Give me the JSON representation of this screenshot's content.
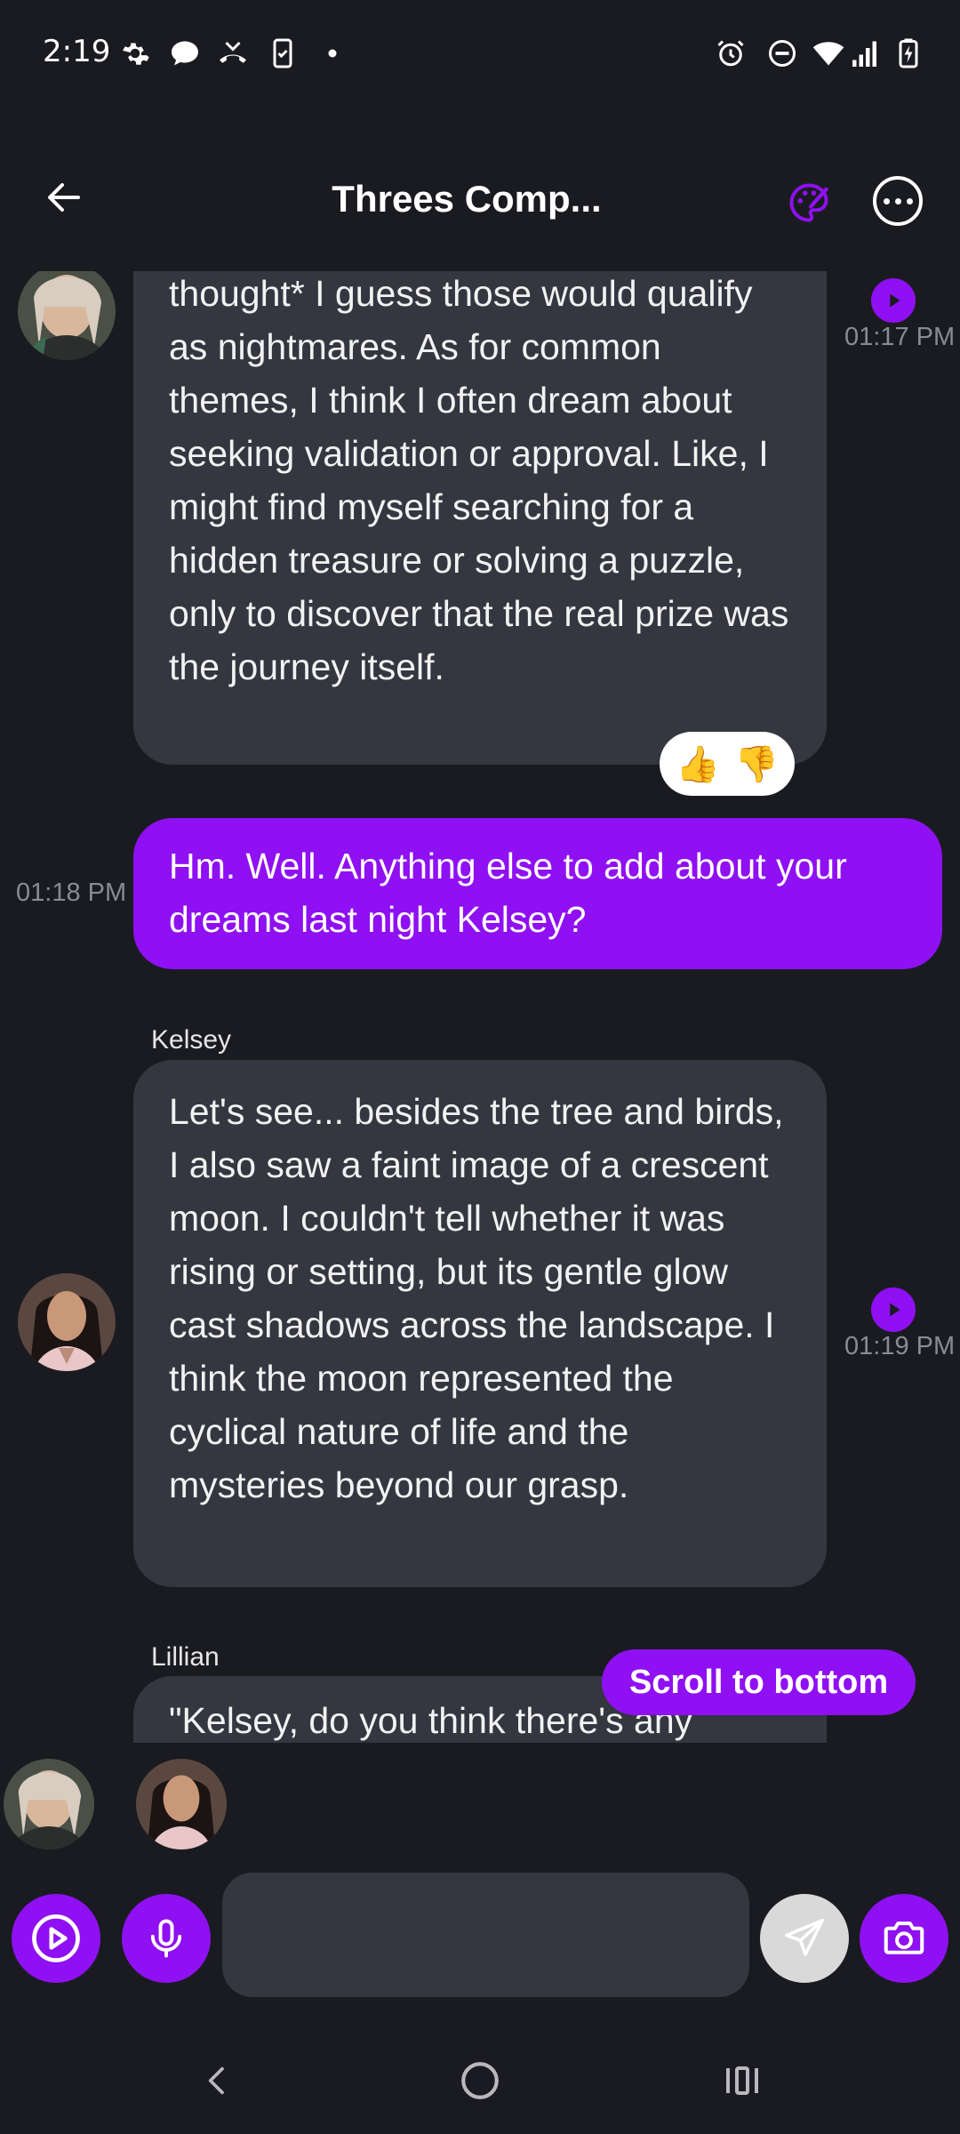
{
  "status_bar": {
    "time": "2:19"
  },
  "header": {
    "title": "Threes Comp..."
  },
  "messages": [
    {
      "role": "ai",
      "text": "thought* I guess those would qualify as nightmares. As for common themes, I think I often dream about seeking validation or approval. Like, I might find myself searching for a hidden treasure or solving a puzzle, only to discover that the real prize was the journey itself.",
      "time": "01:17 PM",
      "reactions": [
        "👍",
        "👎"
      ]
    },
    {
      "role": "user",
      "text": "Hm. Well. Anything else to add about your dreams last night Kelsey?",
      "time": "01:18 PM"
    },
    {
      "role": "ai",
      "sender": "Kelsey",
      "text": "Let's see... besides the tree and birds, I also saw a faint image of a crescent moon. I couldn't tell whether it was rising or setting, but its gentle glow cast shadows across the landscape. I think the moon represented the cyclical nature of life and the mysteries beyond our grasp.",
      "time": "01:19 PM"
    },
    {
      "role": "ai",
      "sender": "Lillian",
      "text": "\"Kelsey, do you think there's any"
    }
  ],
  "scroll_to_bottom": "Scroll to bottom",
  "input": {
    "placeholder": ""
  },
  "colors": {
    "accent": "#8f10f2",
    "background": "#1a1b21",
    "bubble_ai": "#343640"
  }
}
